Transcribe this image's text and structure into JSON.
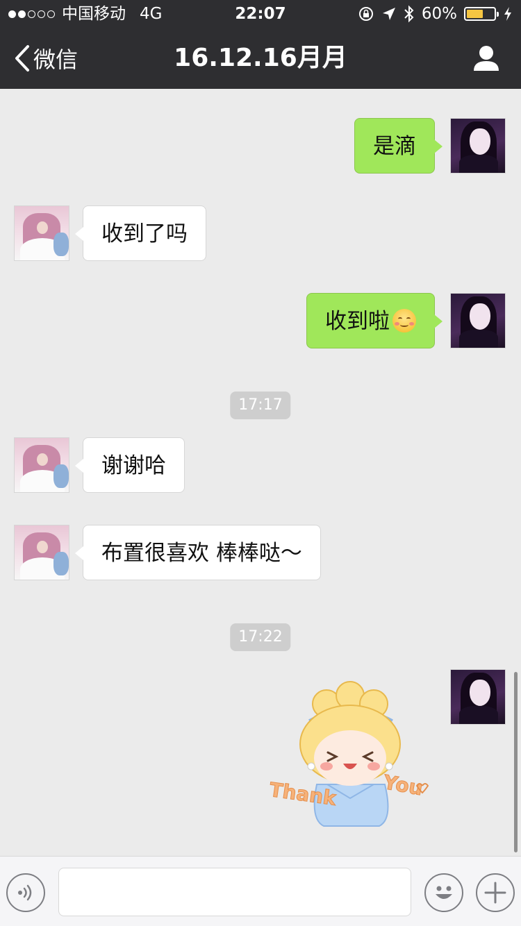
{
  "status_bar": {
    "carrier": "中国移动",
    "network": "4G",
    "time": "22:07",
    "battery_percent": "60%",
    "battery_level": 0.6,
    "icons": [
      "signal-dots-icon",
      "rotation-lock-icon",
      "location-arrow-icon",
      "bluetooth-icon",
      "battery-icon",
      "charging-bolt-icon"
    ]
  },
  "nav": {
    "back_label": "微信",
    "title": "16.12.16月月",
    "icons": [
      "chevron-left-icon",
      "profile-icon"
    ]
  },
  "messages": [
    {
      "side": "out",
      "text": "是滴"
    },
    {
      "side": "in",
      "text": "收到了吗"
    },
    {
      "side": "out",
      "text": "收到啦",
      "emoji": "smiling-face-emoji"
    },
    {
      "timestamp": "17:17"
    },
    {
      "side": "in",
      "text": "谢谢哈"
    },
    {
      "side": "in",
      "text": "布置很喜欢 棒棒哒～"
    },
    {
      "timestamp": "17:22"
    },
    {
      "side": "out",
      "sticker": "thank-you-sticker"
    }
  ],
  "sticker": {
    "word_left": "Thank",
    "word_right": "You"
  },
  "colors": {
    "nav_bg": "#2e2e31",
    "chat_bg": "#ebebeb",
    "outgoing_bubble": "#a0e75a",
    "incoming_bubble": "#ffffff",
    "timestamp_bg": "#cecece",
    "battery": "#f5c542"
  },
  "input_bar": {
    "icons": [
      "voice-icon",
      "emoji-icon",
      "plus-icon"
    ]
  }
}
